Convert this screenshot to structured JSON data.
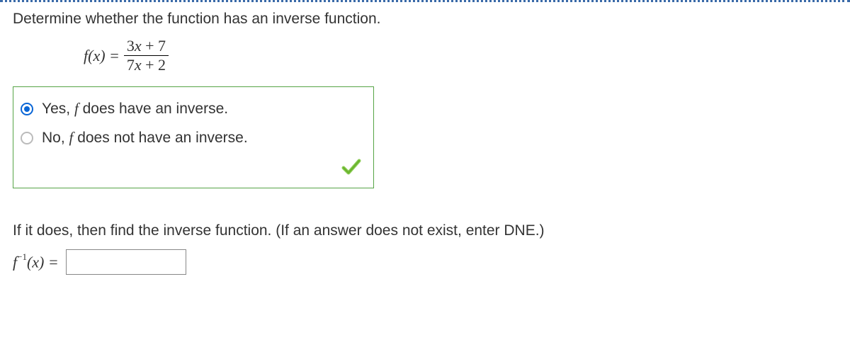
{
  "question": {
    "prompt": "Determine whether the function has an inverse function.",
    "formula": {
      "left": "f(x) =",
      "numerator_a": "3",
      "numerator_var": "x",
      "numerator_b": " + 7",
      "denominator_a": "7",
      "denominator_var": "x",
      "denominator_b": " + 2"
    }
  },
  "options": {
    "yes_prefix": "Yes, ",
    "yes_f": "f",
    "yes_suffix": " does have an inverse.",
    "no_prefix": "No, ",
    "no_f": "f",
    "no_suffix": " does not have an inverse.",
    "selected": "yes",
    "correct": true
  },
  "part2": {
    "prompt": "If it does, then find the inverse function. (If an answer does not exist, enter DNE.)",
    "label_f": "f",
    "label_sup": "−1",
    "label_rest": "(x) =",
    "value": ""
  }
}
